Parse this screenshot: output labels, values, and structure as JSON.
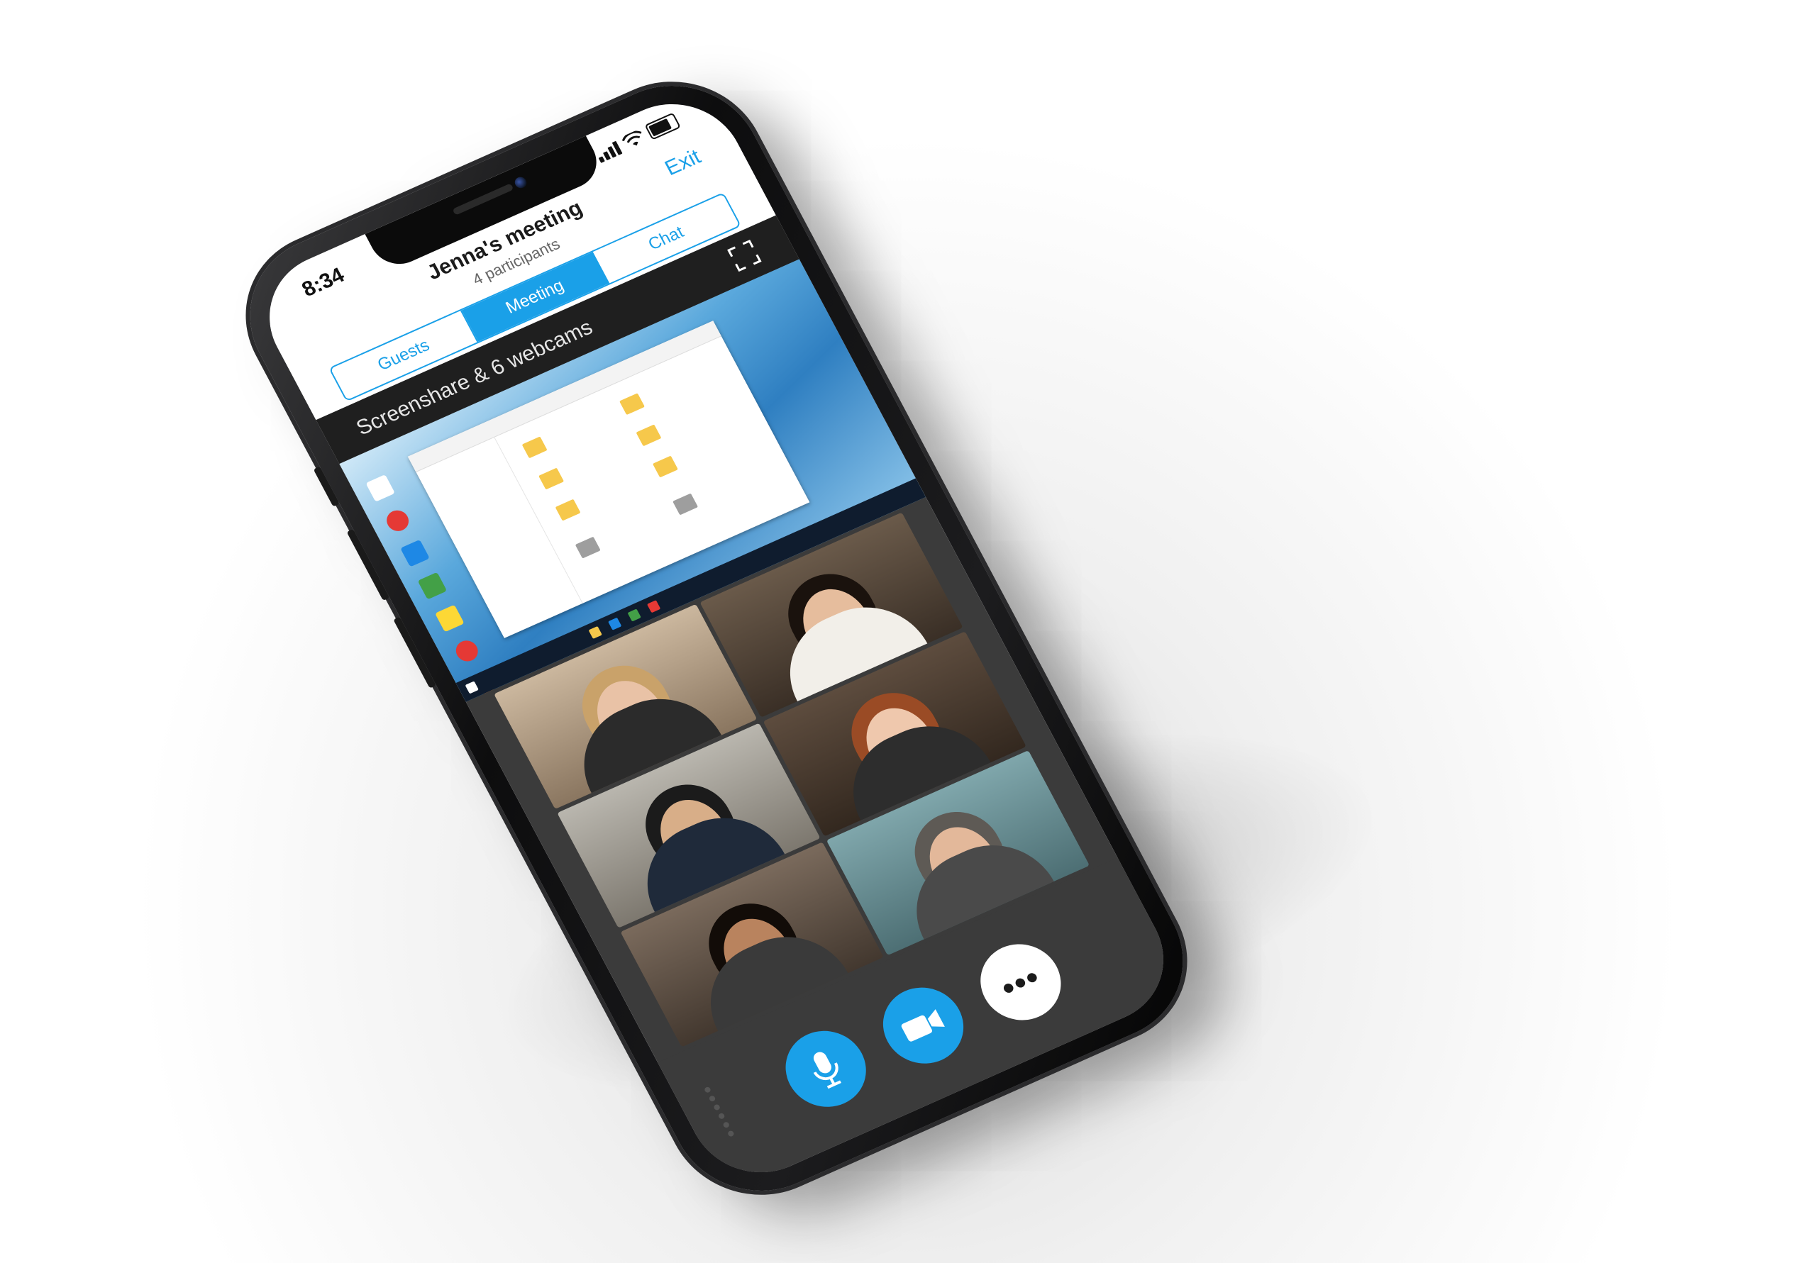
{
  "status": {
    "time": "8:34"
  },
  "meeting": {
    "title": "Jenna's meeting",
    "participants": "4 participants",
    "exit_label": "Exit"
  },
  "tabs": [
    {
      "label": "Guests",
      "active": false
    },
    {
      "label": "Meeting",
      "active": true
    },
    {
      "label": "Chat",
      "active": false
    }
  ],
  "content": {
    "title": "Screenshare & 6 webcams"
  },
  "controls": {
    "more_label": "•••"
  },
  "colors": {
    "accent": "#1aa0e8",
    "content_bg": "#3b3b3b",
    "header_bar": "#1f1f1f"
  },
  "icons": {
    "fullscreen": "fullscreen-icon",
    "microphone": "microphone-icon",
    "video": "video-camera-icon",
    "more": "more-icon"
  }
}
